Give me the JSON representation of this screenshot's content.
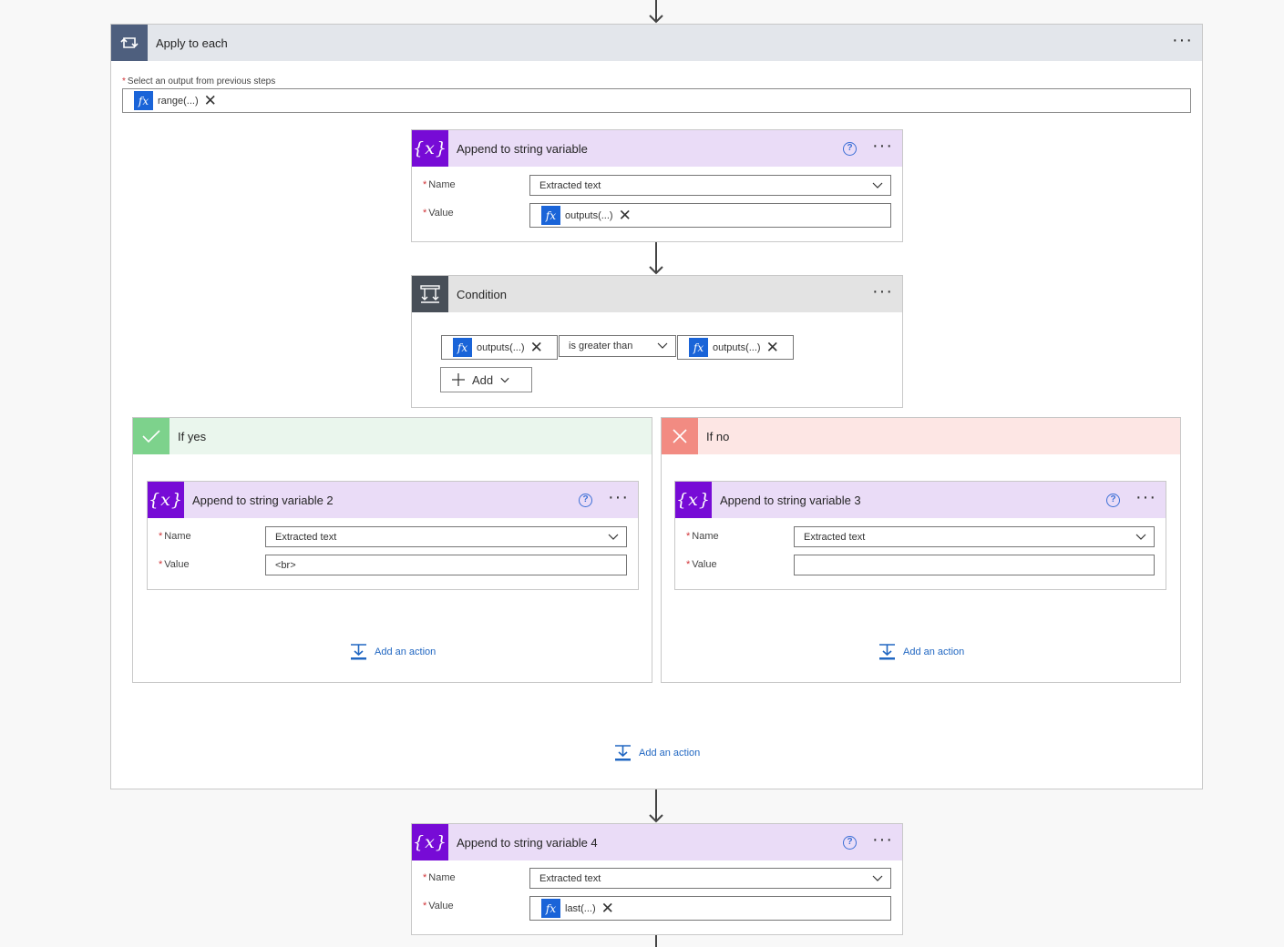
{
  "apply_each": {
    "title": "Apply to each",
    "select_label": "Select an output from previous steps",
    "token": "range(...)",
    "add_action": "Add an action"
  },
  "append1": {
    "title": "Append to string variable",
    "name_label": "Name",
    "name_value": "Extracted text",
    "value_label": "Value",
    "value_token": "outputs(...)"
  },
  "condition": {
    "title": "Condition",
    "left_token": "outputs(...)",
    "operator": "is greater than",
    "right_token": "outputs(...)",
    "add_label": "Add"
  },
  "if_yes": {
    "title": "If yes",
    "card": {
      "title": "Append to string variable 2",
      "name_label": "Name",
      "name_value": "Extracted text",
      "value_label": "Value",
      "value_text": "<br>"
    },
    "add_action": "Add an action"
  },
  "if_no": {
    "title": "If no",
    "card": {
      "title": "Append to string variable 3",
      "name_label": "Name",
      "name_value": "Extracted text",
      "value_label": "Value",
      "value_text": ""
    },
    "add_action": "Add an action"
  },
  "append4": {
    "title": "Append to string variable 4",
    "name_label": "Name",
    "name_value": "Extracted text",
    "value_label": "Value",
    "value_token": "last(...)"
  },
  "icons": {
    "loop": "loop-icon",
    "variable": "variable-icon",
    "condition": "condition-icon",
    "check": "check-icon",
    "close": "close-icon",
    "help": "help-icon",
    "more": "more-options-icon",
    "add_action": "add-action-icon",
    "chevron": "chevron-down-icon",
    "fx": "expression-icon",
    "arrow": "arrow-down-icon"
  },
  "colors": {
    "variable_accent": "#770bd6",
    "condition_accent": "#484f58",
    "loop_accent": "#4e5f7e",
    "yes_accent": "#7dd28c",
    "no_accent": "#f28b82",
    "link": "#2167c2",
    "expression": "#1a64d8"
  }
}
